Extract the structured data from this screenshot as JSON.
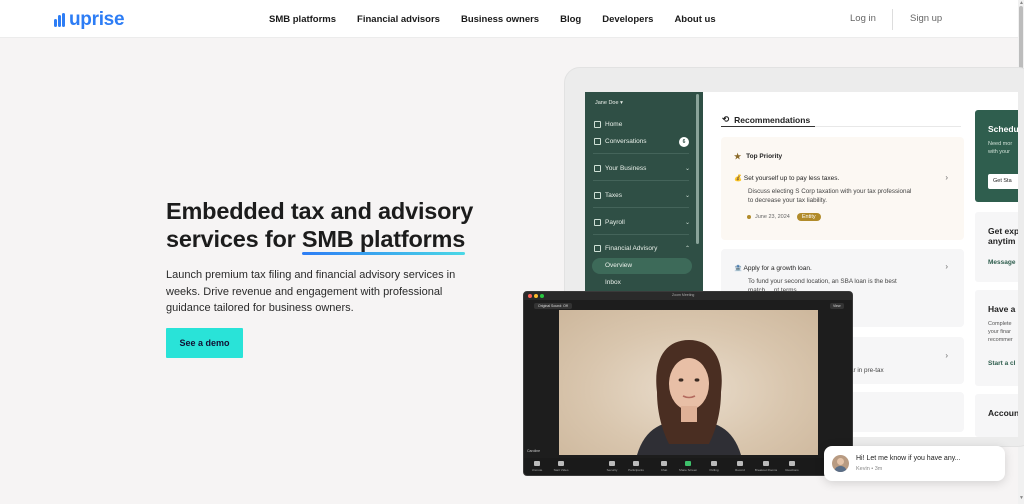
{
  "header": {
    "logo_text": "uprise",
    "nav": [
      "SMB platforms",
      "Financial advisors",
      "Business owners",
      "Blog",
      "Developers",
      "About us"
    ],
    "login_label": "Log in",
    "signup_label": "Sign up"
  },
  "hero": {
    "title_line1": "Embedded tax and advisory",
    "title_line2_prefix": "services for ",
    "title_line2_accent": "SMB platforms",
    "description": "Launch premium tax filing and financial advisory services in weeks. Drive revenue and engagement with professional guidance tailored for business owners.",
    "cta_label": "See a demo"
  },
  "app_mockup": {
    "user": "Jane Doe",
    "sidebar": {
      "home": "Home",
      "conversations": "Conversations",
      "conversations_count": "6",
      "your_business": "Your Business",
      "taxes": "Taxes",
      "payroll": "Payroll",
      "financial_advisory": "Financial Advisory",
      "overview": "Overview",
      "inbox": "Inbox"
    },
    "recommendations_title": "Recommendations",
    "cards": {
      "top_priority": "Top Priority",
      "card1_title": "Set yourself up to pay less taxes.",
      "card1_body_line1": "Discuss electing S Corp taxation with your tax professional",
      "card1_body_line2": "to decrease your tax liability.",
      "card1_date": "June 23, 2024",
      "card1_badge": "Entity",
      "card2_title": "Apply for a growth loan.",
      "card2_body_line1": "To fund your second location, an SBA loan is the best",
      "card2_body_line2": "match ... nt terms.",
      "card3_body": "... $14k/year in pre-tax"
    },
    "right_panels": {
      "schedule_title": "Schedu",
      "schedule_small1": "Need mor",
      "schedule_small2": "with your",
      "schedule_btn": "Get Sta",
      "expert_title1": "Get exp",
      "expert_title2": "anytim",
      "expert_link": "Message",
      "advisor_title": "Have a",
      "advisor_small1": "Complete",
      "advisor_small2": "your finar",
      "advisor_small3": "recommer",
      "advisor_link": "Start a cl",
      "account_title": "Accoun"
    }
  },
  "video_call": {
    "window_title": "Zoom Meeting",
    "chip": "Original Sound: Off",
    "view_label": "View",
    "participant_name": "Caroline",
    "toolbar": [
      "Unmute",
      "Start Video",
      "Security",
      "Participants",
      "Chat",
      "Share Screen",
      "Polling",
      "Record",
      "Breakout Rooms",
      "Reactions",
      "End"
    ]
  },
  "chat": {
    "message": "Hi! Let me know if you have any...",
    "meta": "Kevin • 3m"
  },
  "colors": {
    "brand": "#2d7df5",
    "cta": "#29e3d8",
    "sidebar": "#2f4f45",
    "entity_badge": "#b18b2a"
  }
}
